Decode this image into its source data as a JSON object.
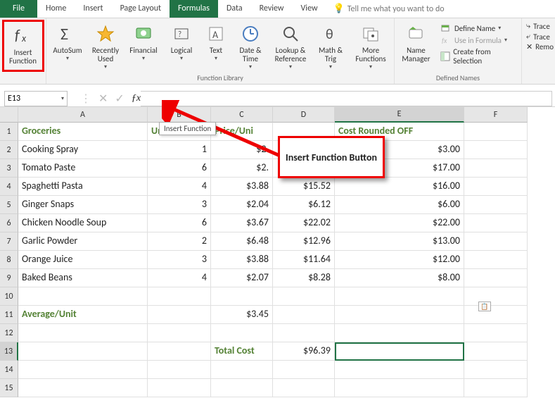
{
  "tabs": {
    "file": "File",
    "home": "Home",
    "insert": "Insert",
    "page_layout": "Page Layout",
    "formulas": "Formulas",
    "data": "Data",
    "review": "Review",
    "view": "View",
    "tell_me": "Tell me what you want to do"
  },
  "ribbon": {
    "insert_function": "Insert\nFunction",
    "autosum": "AutoSum",
    "recently_used": "Recently\nUsed",
    "financial": "Financial",
    "logical": "Logical",
    "text": "Text",
    "date_time": "Date &\nTime",
    "lookup_reference": "Lookup &\nReference",
    "math_trig": "Math &\nTrig",
    "more_functions": "More\nFunctions",
    "name_manager": "Name\nManager",
    "define_name": "Define Name",
    "use_in_formula": "Use in Formula",
    "create_from_selection": "Create from Selection",
    "trace_p": "Trace",
    "trace_d": "Trace",
    "remove": "Remo",
    "group_function_library": "Function Library",
    "group_defined_names": "Defined Names"
  },
  "namebox": "E13",
  "fx_tooltip": "Insert Function",
  "callout": "Insert Function Button",
  "columns": [
    "A",
    "B",
    "C",
    "D",
    "E",
    "F"
  ],
  "rows_headers": [
    "Groceries",
    "Units",
    "Price/Uni",
    "",
    "Cost Rounded OFF",
    ""
  ],
  "rows": [
    {
      "n": "1",
      "a": "Groceries",
      "b": "Units",
      "c": "Price/Uni",
      "d": "",
      "e": "Cost Rounded OFF",
      "f": "",
      "header": true
    },
    {
      "n": "2",
      "a": "Cooking Spray",
      "b": "1",
      "c": "$2.",
      "d": "",
      "e": "$3.00",
      "f": ""
    },
    {
      "n": "3",
      "a": "Tomato Paste",
      "b": "6",
      "c": "$2.",
      "d": "",
      "e": "$17.00",
      "f": ""
    },
    {
      "n": "4",
      "a": "Spaghetti Pasta",
      "b": "4",
      "c": "$3.88",
      "d": "$15.52",
      "e": "$16.00",
      "f": ""
    },
    {
      "n": "5",
      "a": "Ginger Snaps",
      "b": "3",
      "c": "$2.04",
      "d": "$6.12",
      "e": "$6.00",
      "f": ""
    },
    {
      "n": "6",
      "a": "Chicken Noodle Soup",
      "b": "6",
      "c": "$3.67",
      "d": "$22.02",
      "e": "$22.00",
      "f": ""
    },
    {
      "n": "7",
      "a": "Garlic Powder",
      "b": "2",
      "c": "$6.48",
      "d": "$12.96",
      "e": "$13.00",
      "f": ""
    },
    {
      "n": "8",
      "a": "Orange Juice",
      "b": "3",
      "c": "$3.88",
      "d": "$11.64",
      "e": "$12.00",
      "f": ""
    },
    {
      "n": "9",
      "a": "Baked Beans",
      "b": "4",
      "c": "$2.07",
      "d": "$8.28",
      "e": "$8.00",
      "f": ""
    },
    {
      "n": "10",
      "a": "",
      "b": "",
      "c": "",
      "d": "",
      "e": "",
      "f": ""
    },
    {
      "n": "11",
      "a": "Average/Unit",
      "b": "",
      "c": "$3.45",
      "d": "",
      "e": "",
      "f": "",
      "ah": true
    },
    {
      "n": "12",
      "a": "",
      "b": "",
      "c": "",
      "d": "",
      "e": "",
      "f": ""
    },
    {
      "n": "13",
      "a": "",
      "b": "",
      "c": "Total Cost",
      "d": "$96.39",
      "e": "",
      "f": "",
      "ch": true,
      "selected": "e"
    },
    {
      "n": "14",
      "a": "",
      "b": "",
      "c": "",
      "d": "",
      "e": "",
      "f": ""
    },
    {
      "n": "15",
      "a": "",
      "b": "",
      "c": "",
      "d": "",
      "e": "",
      "f": ""
    }
  ]
}
